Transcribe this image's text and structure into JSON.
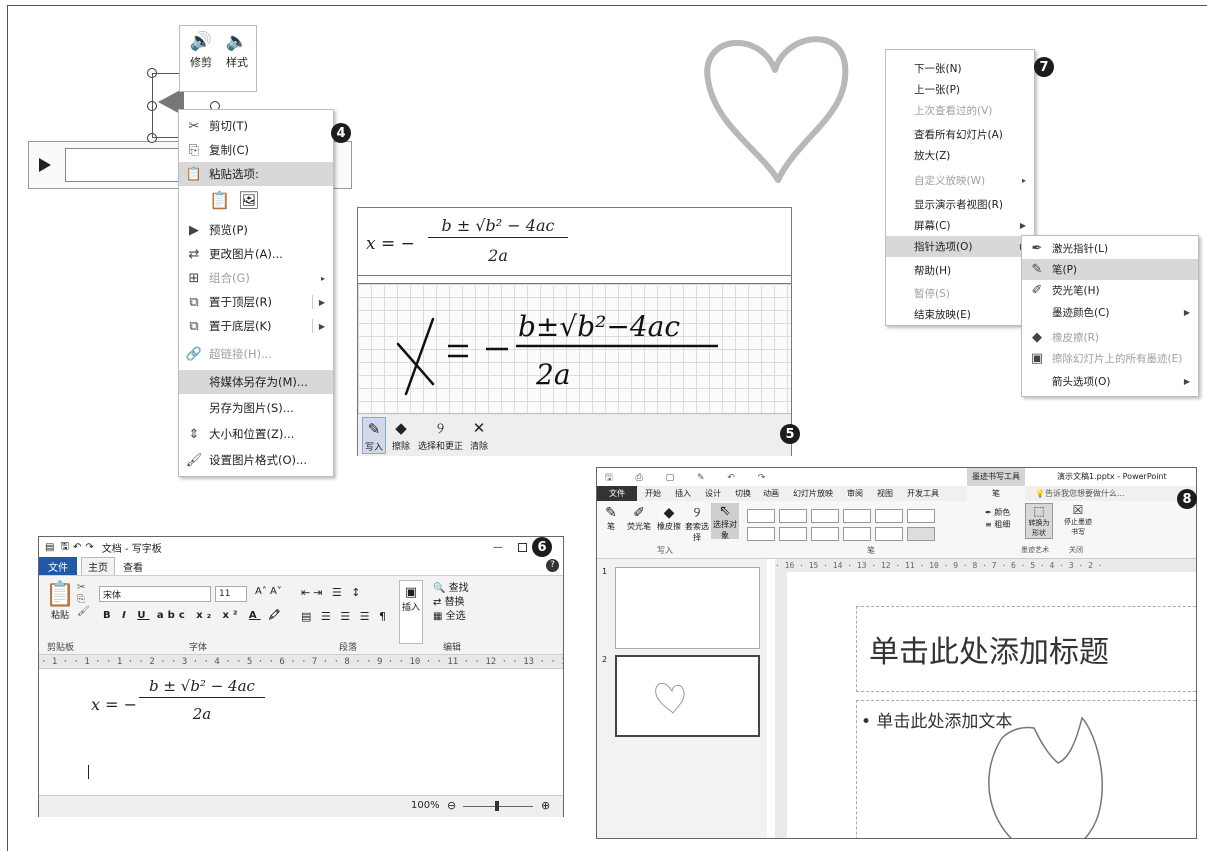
{
  "badges": {
    "p4": "4",
    "p5": "5",
    "p6": "6",
    "p7": "7",
    "p8": "8"
  },
  "panel4": {
    "mini_toolbar": [
      {
        "label": "修剪",
        "icon": "trim-icon"
      },
      {
        "label": "样式",
        "icon": "style-icon"
      }
    ],
    "menu": [
      {
        "label": "剪切(T)",
        "icon": "scissors-icon",
        "state": "normal"
      },
      {
        "label": "复制(C)",
        "icon": "copy-icon",
        "state": "normal"
      },
      {
        "label": "粘贴选项:",
        "icon": "paste-icon",
        "state": "header"
      },
      {
        "label": "",
        "icon": "paste-options-icon",
        "state": "icons"
      },
      {
        "label": "预览(P)",
        "icon": "play-icon",
        "state": "normal"
      },
      {
        "label": "更改图片(A)...",
        "icon": "change-picture-icon",
        "state": "normal"
      },
      {
        "label": "组合(G)",
        "icon": "group-icon",
        "state": "disabled",
        "arrow": true
      },
      {
        "label": "置于顶层(R)",
        "icon": "bring-front-icon",
        "state": "normal",
        "arrow": true
      },
      {
        "label": "置于底层(K)",
        "icon": "send-back-icon",
        "state": "normal",
        "arrow": true
      },
      {
        "label": "超链接(H)...",
        "icon": "hyperlink-icon",
        "state": "disabled"
      },
      {
        "label": "将媒体另存为(M)...",
        "icon": "",
        "state": "highlight"
      },
      {
        "label": "另存为图片(S)...",
        "icon": "",
        "state": "normal"
      },
      {
        "label": "大小和位置(Z)...",
        "icon": "size-position-icon",
        "state": "normal"
      },
      {
        "label": "设置图片格式(O)...",
        "icon": "format-picture-icon",
        "state": "normal"
      }
    ]
  },
  "panel5": {
    "tools": [
      {
        "label": "写入",
        "icon": "pen-icon"
      },
      {
        "label": "擦除",
        "icon": "eraser-icon"
      },
      {
        "label": "选择和更正",
        "icon": "lasso-icon"
      },
      {
        "label": "清除",
        "icon": "clear-icon"
      }
    ]
  },
  "formula": {
    "x": "x = −",
    "numerator": "b ± √b² − 4ac",
    "denominator": "2a"
  },
  "panel6": {
    "title": "文档 - 写字板",
    "tabs": [
      "文件",
      "主页",
      "查看"
    ],
    "font_name": "宋体",
    "font_size": "11",
    "clipboard_label": "剪贴板",
    "paste_label": "粘贴",
    "font_group": "字体",
    "paragraph_group": "段落",
    "insert_label": "插入",
    "edit_group": "编辑",
    "find": "查找",
    "replace": "替换",
    "select_all": "全选",
    "ruler": "· 1 · · 1 · · 1 · · 2 · · 3 · · 4 · · 5 · · 6 · · 7 · · 8 · · 9 · · 10 · · 11 · · 12 · · 13 · · 14 · · 15 · · 16 ·",
    "zoom": "100%"
  },
  "panel7": {
    "menu": [
      {
        "label": "下一张(N)",
        "state": "normal"
      },
      {
        "label": "上一张(P)",
        "state": "normal"
      },
      {
        "label": "上次查看过的(V)",
        "state": "disabled"
      },
      {
        "label": "查看所有幻灯片(A)",
        "state": "normal"
      },
      {
        "label": "放大(Z)",
        "state": "normal"
      },
      {
        "label": "自定义放映(W)",
        "state": "disabled",
        "arrow": true
      },
      {
        "label": "显示演示者视图(R)",
        "state": "normal"
      },
      {
        "label": "屏幕(C)",
        "state": "normal",
        "arrow": true
      },
      {
        "label": "指针选项(O)",
        "state": "highlight",
        "arrow": true
      },
      {
        "label": "帮助(H)",
        "state": "normal"
      },
      {
        "label": "暂停(S)",
        "state": "disabled"
      },
      {
        "label": "结束放映(E)",
        "state": "normal"
      }
    ],
    "submenu": [
      {
        "label": "激光指针(L)",
        "icon": "laser-pointer-icon",
        "state": "normal"
      },
      {
        "label": "笔(P)",
        "icon": "pen-icon",
        "state": "highlight"
      },
      {
        "label": "荧光笔(H)",
        "icon": "highlighter-icon",
        "state": "normal"
      },
      {
        "label": "墨迹颜色(C)",
        "icon": "",
        "state": "normal",
        "arrow": true
      },
      {
        "label": "橡皮擦(R)",
        "icon": "eraser-icon",
        "state": "disabled"
      },
      {
        "label": "擦除幻灯片上的所有墨迹(E)",
        "icon": "erase-all-icon",
        "state": "disabled"
      },
      {
        "label": "箭头选项(O)",
        "icon": "",
        "state": "normal",
        "arrow": true
      }
    ]
  },
  "panel8": {
    "context_tab": "墨迹书写工具",
    "window_title": "演示文稿1.pptx - PowerPoint",
    "tabs": [
      "文件",
      "开始",
      "插入",
      "设计",
      "切换",
      "动画",
      "幻灯片放映",
      "审阅",
      "视图",
      "开发工具",
      "笔"
    ],
    "tell_me": "告诉我您想要做什么...",
    "tools": [
      "笔",
      "荧光笔",
      "橡皮擦",
      "套索选择",
      "选择对象"
    ],
    "write_group": "写入",
    "pens_group": "笔",
    "color_label": "颜色",
    "thickness_label": "粗细",
    "convert_label": "转换为形状",
    "stop_label": "停止墨迹书写",
    "ink_art_group": "墨迹艺术",
    "close_group": "关闭",
    "ruler": "· 16 · 15 · 14 · 13 · 12 · 11 · 10 · 9 · 8 · 7 · 6 · 5 · 4 · 3 · 2 ·",
    "slide_numbers": [
      "1",
      "2"
    ],
    "title_placeholder": "单击此处添加标题",
    "body_placeholder": "• 单击此处添加文本"
  }
}
